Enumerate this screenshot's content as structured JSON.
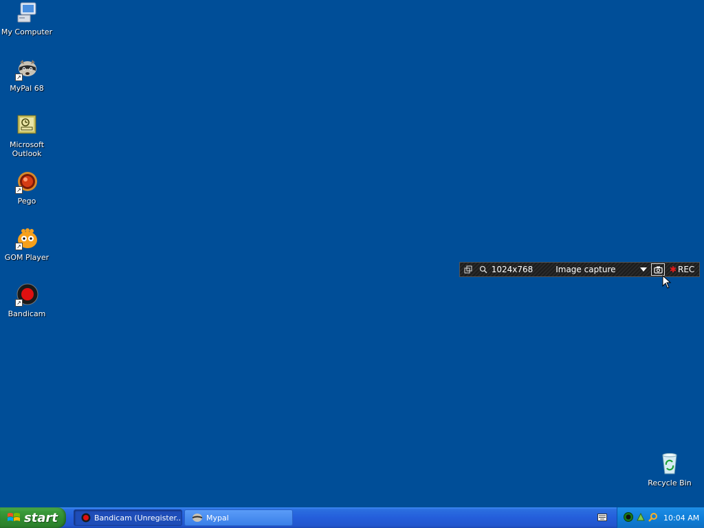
{
  "desktop": {
    "background": "#004e98",
    "icons": [
      {
        "label": "My Computer",
        "icon": "computer-icon"
      },
      {
        "label": "MyPal 68",
        "icon": "mypal-raccoon-icon"
      },
      {
        "label": "Microsoft Outlook",
        "icon": "outlook-icon"
      },
      {
        "label": "Pego",
        "icon": "pego-icon"
      },
      {
        "label": "GOM Player",
        "icon": "gom-player-icon"
      },
      {
        "label": "Bandicam",
        "icon": "bandicam-icon"
      },
      {
        "label": "Recycle Bin",
        "icon": "recycle-bin-icon"
      }
    ]
  },
  "bandicam_bar": {
    "resolution": "1024x768",
    "mode": "Image capture",
    "rec_label": "REC"
  },
  "taskbar": {
    "start_label": "start",
    "tasks": [
      {
        "label": "Bandicam (Unregister...",
        "icon": "bandicam-icon"
      },
      {
        "label": "Mypal",
        "icon": "mypal-raccoon-icon"
      }
    ],
    "clock": "10:04 AM"
  }
}
